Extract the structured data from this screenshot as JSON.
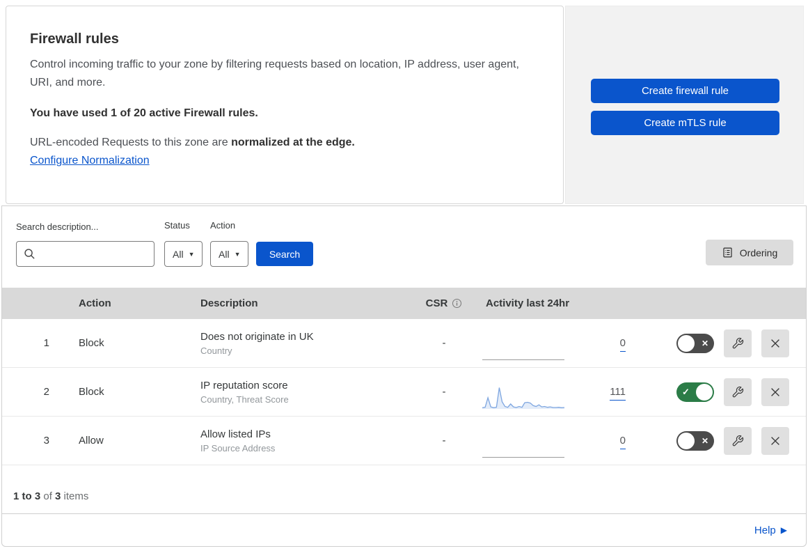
{
  "header": {
    "title": "Firewall rules",
    "description": "Control incoming traffic to your zone by filtering requests based on location, IP address, user agent, URI, and more.",
    "usage_summary": "You have used 1 of 20 active Firewall rules.",
    "normalization_text": "URL-encoded Requests to this zone are ",
    "normalization_bold": "normalized at the edge.",
    "normalization_link": "Configure Normalization",
    "create_firewall_button": "Create firewall rule",
    "create_mtls_button": "Create mTLS rule"
  },
  "filters": {
    "search_label": "Search description...",
    "search_value": "",
    "status_label": "Status",
    "status_value": "All",
    "action_label": "Action",
    "action_value": "All",
    "search_button": "Search",
    "ordering_button": "Ordering"
  },
  "table": {
    "columns": {
      "action": "Action",
      "description": "Description",
      "csr": "CSR",
      "activity": "Activity last 24hr"
    },
    "rows": [
      {
        "priority": "1",
        "action": "Block",
        "description": "Does not originate in UK",
        "fields": "Country",
        "csr": "-",
        "activity_count": "0",
        "enabled": false,
        "sparkline": []
      },
      {
        "priority": "2",
        "action": "Block",
        "description": "IP reputation score",
        "fields": "Country, Threat Score",
        "csr": "-",
        "activity_count": "111",
        "enabled": true,
        "sparkline": [
          4,
          6,
          52,
          8,
          4,
          6,
          100,
          32,
          10,
          6,
          22,
          8,
          5,
          10,
          6,
          28,
          30,
          26,
          14,
          10,
          18,
          8,
          10,
          6,
          8,
          5,
          5,
          6,
          4,
          5
        ]
      },
      {
        "priority": "3",
        "action": "Allow",
        "description": "Allow listed IPs",
        "fields": "IP Source Address",
        "csr": "-",
        "activity_count": "0",
        "enabled": false,
        "sparkline": []
      }
    ]
  },
  "footer": {
    "pagination_range": "1 to 3",
    "pagination_of": " of ",
    "pagination_total": "3",
    "pagination_items": " items",
    "help_label": "Help"
  },
  "icons": {
    "search-icon": "magnifier",
    "chevron-down-icon": "down-triangle",
    "ordering-icon": "list-document",
    "info-icon": "circled-i",
    "wrench-icon": "wrench",
    "close-icon": "x",
    "toggle-check-icon": "check",
    "toggle-x-icon": "x",
    "help-arrow-icon": "right-triangle"
  },
  "colors": {
    "accent_blue": "#0a55cc",
    "toggle_on_green": "#2b7c47",
    "toggle_off_gray": "#4b4b4b",
    "table_header_gray": "#d9d9d9",
    "panel_gray": "#f2f2f2",
    "sparkline_blue": "#7ea6e0"
  }
}
